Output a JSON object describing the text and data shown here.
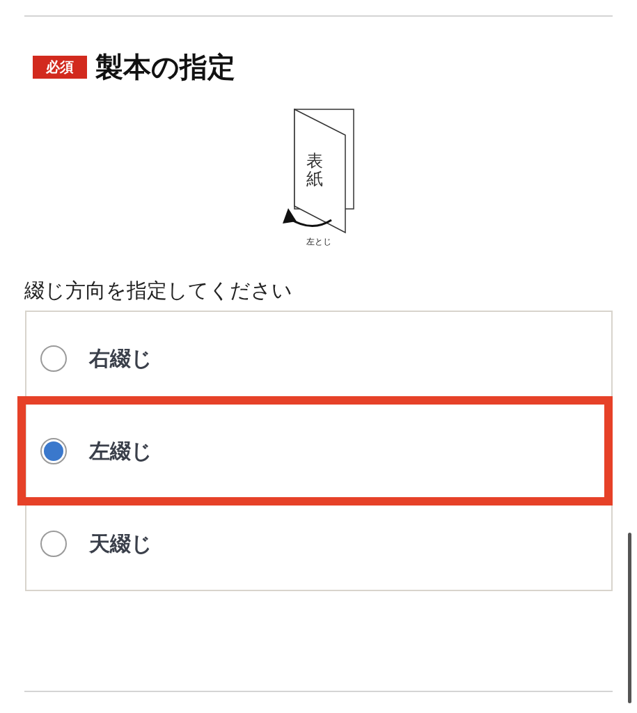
{
  "section": {
    "badge": "必須",
    "title": "製本の指定"
  },
  "illustration": {
    "cover_label": "表紙",
    "binding_label": "左とじ"
  },
  "prompt": "綴じ方向を指定してください",
  "options": [
    {
      "label": "右綴じ",
      "selected": false,
      "highlighted": false
    },
    {
      "label": "左綴じ",
      "selected": true,
      "highlighted": true
    },
    {
      "label": "天綴じ",
      "selected": false,
      "highlighted": false
    }
  ]
}
